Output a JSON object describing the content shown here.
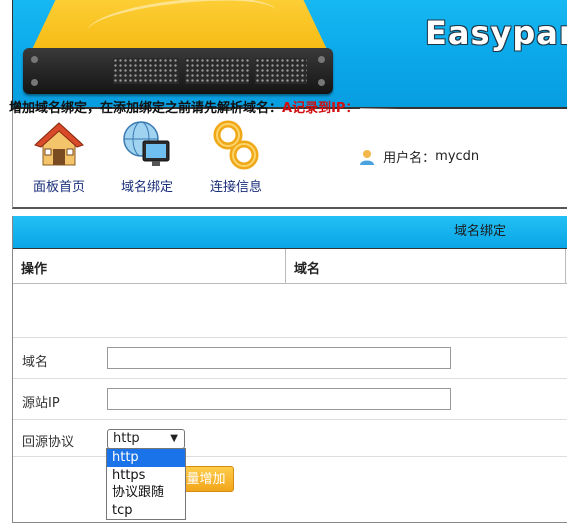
{
  "banner": {
    "brand": "Easypanel"
  },
  "nav": {
    "items": [
      {
        "label": "面板首页",
        "icon": "home-icon"
      },
      {
        "label": "域名绑定",
        "icon": "globe-monitor-icon"
      },
      {
        "label": "连接信息",
        "icon": "chain-link-icon"
      }
    ],
    "user_label": "用户名：",
    "username": "mycdn"
  },
  "main": {
    "title": "域名绑定",
    "columns": [
      "操作",
      "域名"
    ],
    "notice_prefix": "增加域名绑定，在添加绑定之前请先解析域名：",
    "notice_highlight": "A记录到IP：",
    "form": {
      "domain_label": "域名",
      "domain_value": "",
      "source_ip_label": "源站IP",
      "source_ip_value": "",
      "protocol_label": "回源协议",
      "protocol_selected": "http",
      "protocol_options": [
        "http",
        "https",
        "协议跟随",
        "tcp"
      ]
    },
    "add_button_label": "量增加"
  },
  "colors": {
    "banner_blue": "#0aa6e8",
    "nav_text": "#1a2f7a",
    "notice_red": "#d01010",
    "button_orange": "#f2a51a",
    "option_selected": "#1a73e8"
  }
}
